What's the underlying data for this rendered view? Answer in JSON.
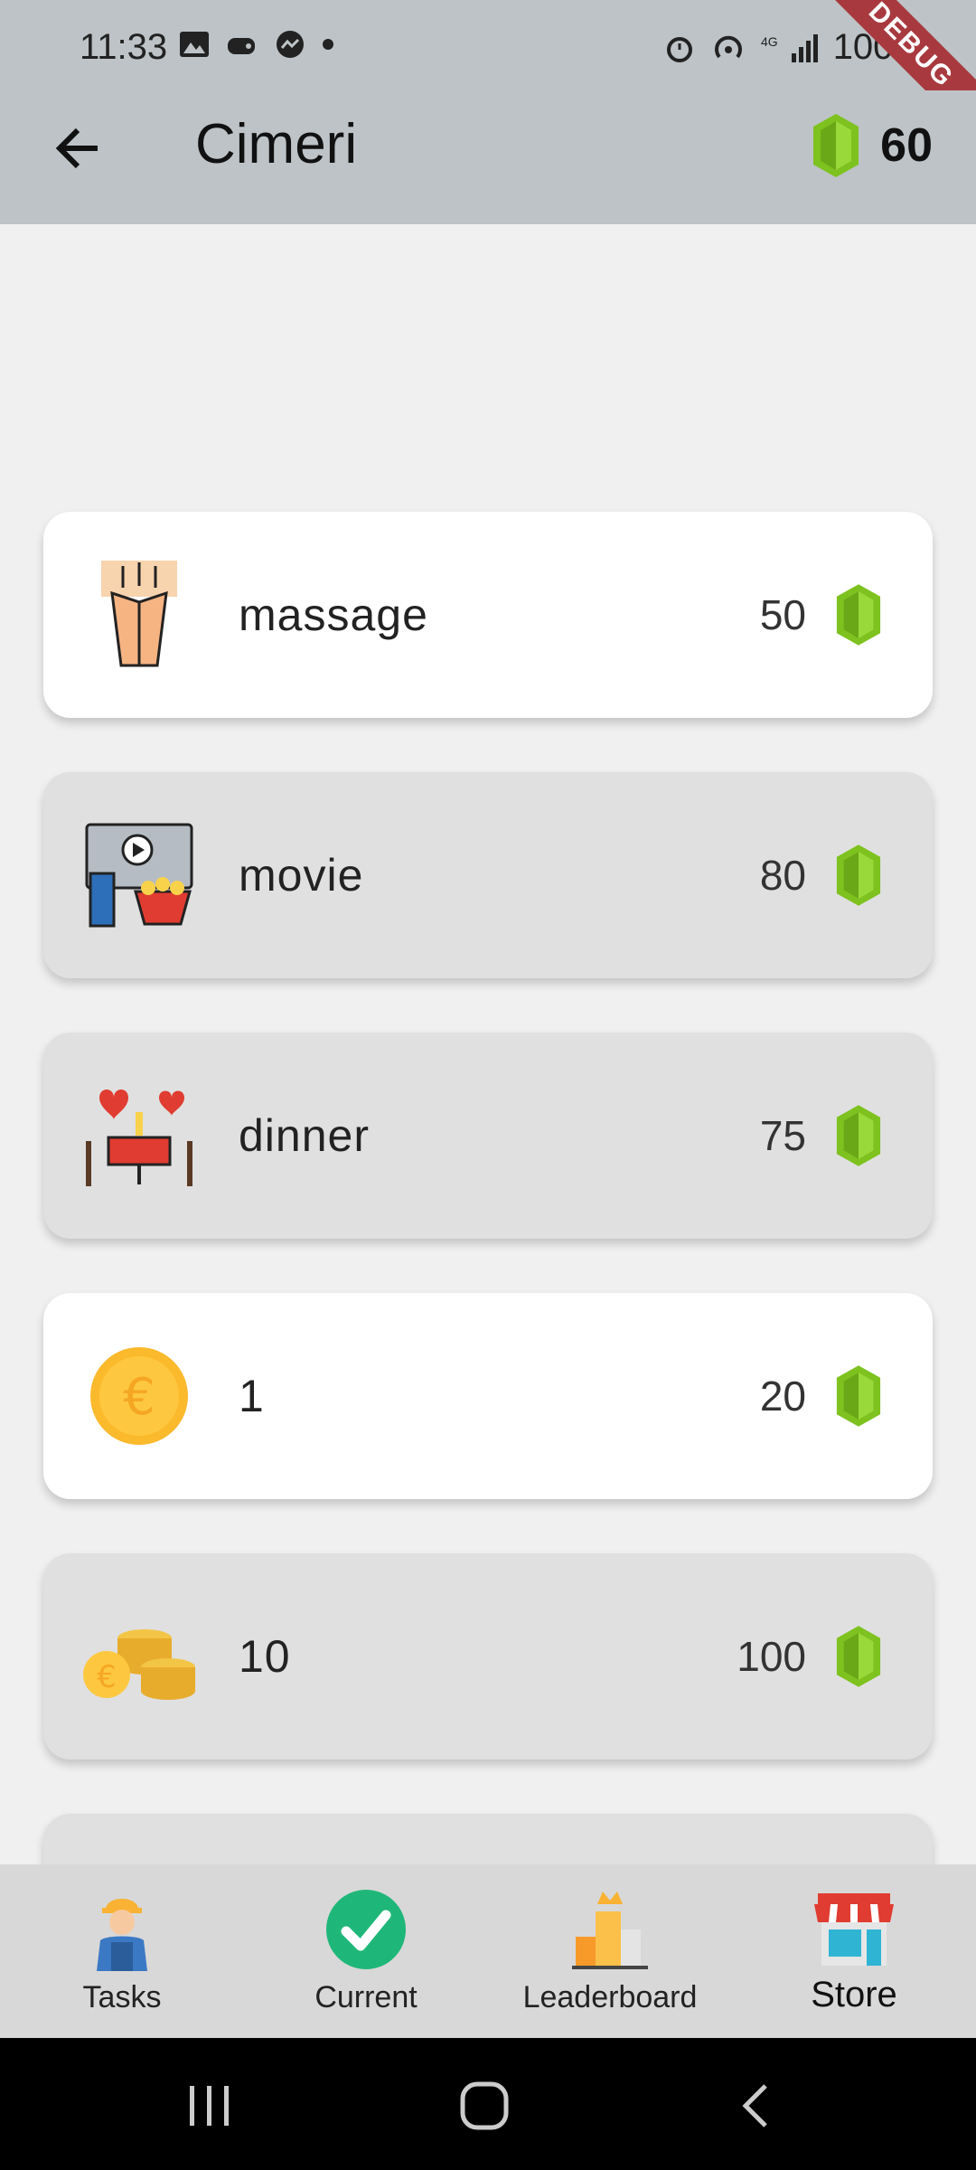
{
  "status_bar": {
    "time": "11:33",
    "battery": "100%",
    "debug_banner": "DEBUG"
  },
  "app_bar": {
    "title": "Cimeri",
    "gem_balance": "60"
  },
  "colors": {
    "gem": "#7dc21e",
    "app_bar": "#bdc3c6",
    "accent_check": "#1fb779"
  },
  "store_items": [
    {
      "label": "massage",
      "price": "50",
      "icon": "massage-icon",
      "style": "white"
    },
    {
      "label": "movie",
      "price": "80",
      "icon": "movie-icon",
      "style": "grey"
    },
    {
      "label": "dinner",
      "price": "75",
      "icon": "dinner-icon",
      "style": "grey"
    },
    {
      "label": "1",
      "price": "20",
      "icon": "euro-coin-icon",
      "style": "white"
    },
    {
      "label": "10",
      "price": "100",
      "icon": "coin-stack-icon",
      "style": "grey"
    }
  ],
  "bottom_nav": [
    {
      "label": "Tasks",
      "icon": "worker-icon"
    },
    {
      "label": "Current",
      "icon": "check-circle-icon"
    },
    {
      "label": "Leaderboard",
      "icon": "podium-icon"
    },
    {
      "label": "Store",
      "icon": "store-icon",
      "active": true
    }
  ]
}
